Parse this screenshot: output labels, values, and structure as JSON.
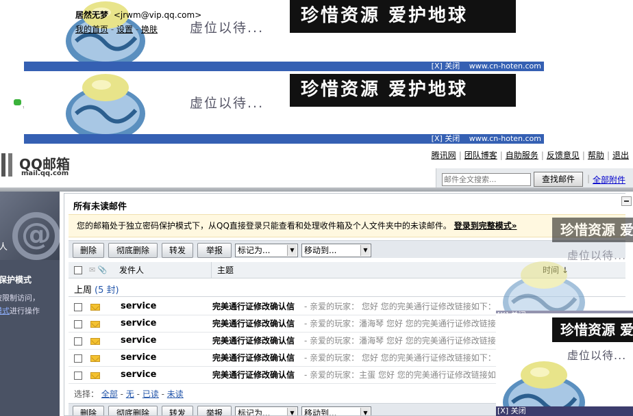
{
  "user": {
    "nickname": "居然无梦",
    "email": "<jrwm@vip.qq.com>",
    "links": [
      "我的首页",
      "设置",
      "换肤"
    ],
    "separator": "-"
  },
  "ad": {
    "slogan": "珍惜资源  爱护地球",
    "vacant": "虚位以待...",
    "close": "[X] 关闭",
    "site": "www.cn-hoten.com"
  },
  "chat": {
    "text": "ᠵ"
  },
  "logo": {
    "name": "QQ邮箱",
    "domain": "mail.qq.com"
  },
  "topnav": [
    "腾讯网",
    "团队博客",
    "自助服务",
    "反馈意见",
    "帮助",
    "退出"
  ],
  "search": {
    "placeholder": "邮件全文搜索...",
    "button": "查找邮件",
    "all_attachments": "全部附件"
  },
  "sidebar": {
    "person": "人",
    "title": "保护模式",
    "desc_line1": "被限制访问，",
    "desc_link": "模式",
    "desc_line2_suffix": "进行操作"
  },
  "main": {
    "heading": "所有未读邮件",
    "notice_text": "您的邮箱处于独立密码保护模式下，从QQ直接登录只能查看和处理收件箱及个人文件夹中的未读邮件。",
    "notice_link": "登录到完整模式»"
  },
  "toolbar": {
    "delete": "删除",
    "delete_forever": "彻底删除",
    "forward": "转发",
    "report": "举报",
    "mark_as": "标记为...",
    "move_to": "移动到..."
  },
  "table": {
    "sender_header": "发件人",
    "subject_header": "主题",
    "time_header": "时间 ↓",
    "group_label": "上周",
    "group_count": "(5 封)",
    "rows": [
      {
        "sender": "service",
        "subject": "完美通行证修改确认信",
        "summary": "- 亲爱的玩家：  您好 您的完美通行证修改链接如下："
      },
      {
        "sender": "service",
        "subject": "完美通行证修改确认信",
        "summary": "- 亲爱的玩家：潘海琴 您好 您的完美通行证修改链接"
      },
      {
        "sender": "service",
        "subject": "完美通行证修改确认信",
        "summary": "- 亲爱的玩家：潘海琴 您好 您的完美通行证修改链接"
      },
      {
        "sender": "service",
        "subject": "完美通行证修改确认信",
        "summary": "- 亲爱的玩家：  您好 您的完美通行证修改链接如下："
      },
      {
        "sender": "service",
        "subject": "完美通行证修改确认信",
        "summary": "- 亲爱的玩家：主蛋 您好 您的完美通行证修改链接如"
      }
    ]
  },
  "selectbar": {
    "label": "选择：",
    "all": "全部",
    "none": "无",
    "read": "已读",
    "unread": "未读"
  }
}
